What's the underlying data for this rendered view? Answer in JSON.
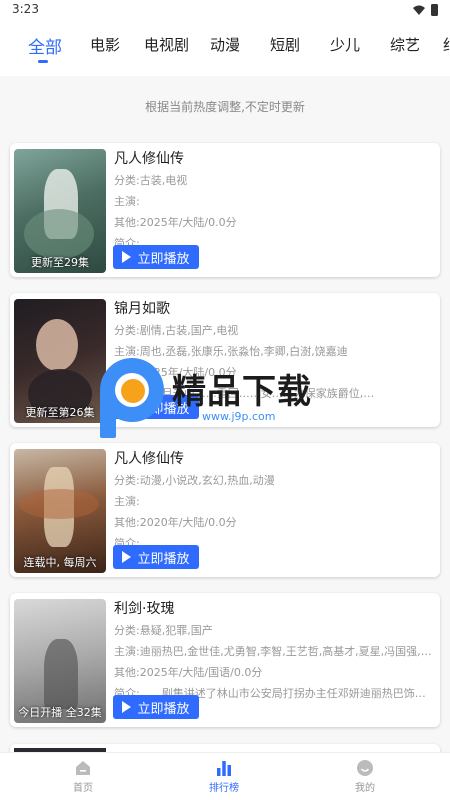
{
  "status_bar": {
    "time": "3:23"
  },
  "tabs": [
    {
      "label": "全部",
      "active": true
    },
    {
      "label": "电影"
    },
    {
      "label": "电视剧"
    },
    {
      "label": "动漫"
    },
    {
      "label": "短剧"
    },
    {
      "label": "少儿"
    },
    {
      "label": "综艺"
    },
    {
      "label": "纪"
    }
  ],
  "notice": "根据当前热度调整,不定时更新",
  "colors": {
    "accent": "#2f6bff",
    "background": "#f7f7f7"
  },
  "play_label": "立即播放",
  "cards": [
    {
      "title": "凡人修仙传",
      "category": "分类:古装,电视",
      "cast": "主演:",
      "other": "其他:2025年/大陆/0.0分",
      "intro": "简介:",
      "poster_label": "更新至29集"
    },
    {
      "title": "锦月如歌",
      "category": "分类:剧情,古装,国产,电视",
      "cast": "主演:周也,丞磊,张康乐,张淼怡,李卿,白澍,饶嘉迪",
      "other": "其他:2025年/大陆/0.0分",
      "intro": "简介:　　月千山……重回……女……为保家族爵位,…",
      "poster_label": "更新至第26集"
    },
    {
      "title": "凡人修仙传",
      "category": "分类:动漫,小说改,玄幻,热血,动漫",
      "cast": "主演:",
      "other": "其他:2020年/大陆/0.0分",
      "intro": "简介:",
      "poster_label": "连载中, 每周六"
    },
    {
      "title": "利剑·玫瑰",
      "category": "分类:悬疑,犯罪,国产",
      "cast": "主演:迪丽热巴,金世佳,尤勇智,李智,王艺哲,高基才,夏星,冯国强,那…",
      "other": "其他:2025年/大陆/国语/0.0分",
      "intro": "简介:　　剧集讲述了林山市公安局打拐办主任邓妍迪丽热巴饰与警…",
      "poster_label": "今日开播 全32集"
    }
  ],
  "watermark": {
    "text": "精品下载",
    "url": "www.j9p.com"
  },
  "bottom_nav": [
    {
      "label": "首页",
      "icon": "home-icon"
    },
    {
      "label": "排行榜",
      "icon": "rank-bar-chart-icon",
      "active": true
    },
    {
      "label": "我的",
      "icon": "profile-smile-icon"
    }
  ]
}
